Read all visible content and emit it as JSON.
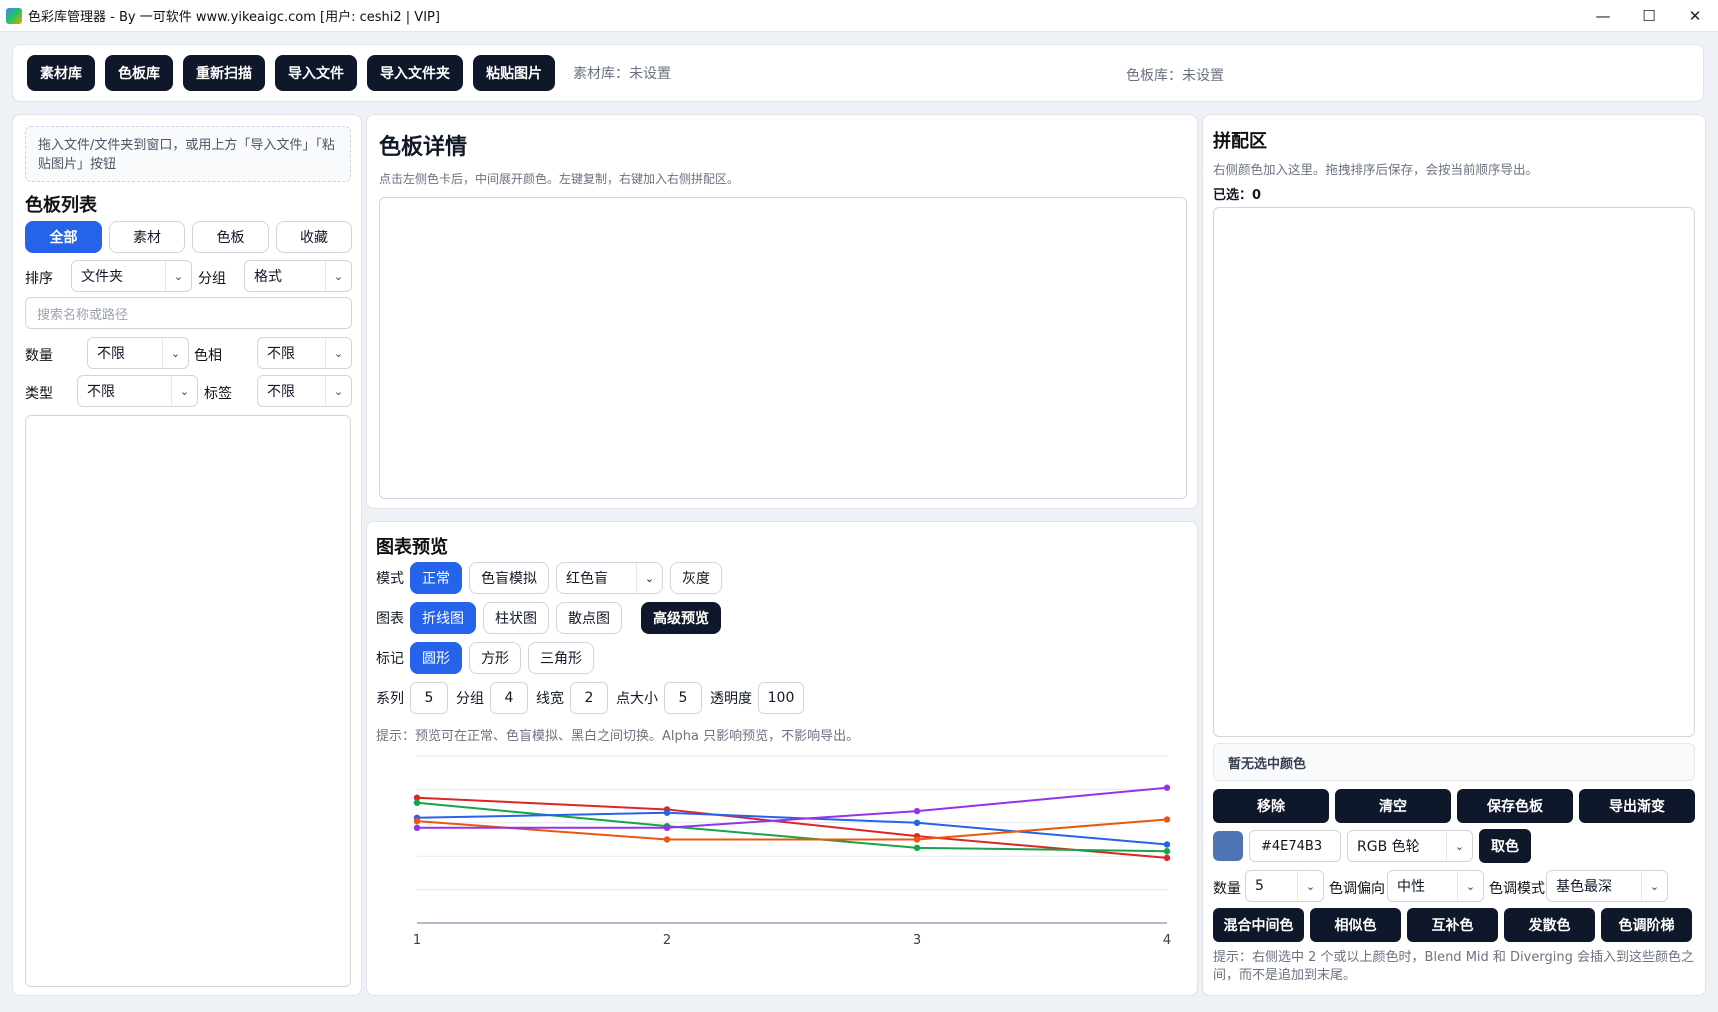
{
  "window": {
    "title": "色彩库管理器 - By 一可软件 www.yikeaigc.com  [用户: ceshi2 | VIP]",
    "minimize": "—",
    "maximize": "☐",
    "close": "✕"
  },
  "toolbar": {
    "buttons": [
      "素材库",
      "色板库",
      "重新扫描",
      "导入文件",
      "导入文件夹",
      "粘贴图片"
    ],
    "asset_status": "素材库：未设置",
    "palette_status": "色板库：未设置"
  },
  "left": {
    "dropzone_text": "拖入文件/文件夹到窗口，或用上方「导入文件」「粘贴图片」按钮",
    "title": "色板列表",
    "tabs": [
      "全部",
      "素材",
      "色板",
      "收藏"
    ],
    "sort_label": "排序",
    "sort_value": "文件夹",
    "group_label": "分组",
    "group_value": "格式",
    "search_placeholder": "搜索名称或路径",
    "count_label": "数量",
    "count_value": "不限",
    "hue_label": "色相",
    "hue_value": "不限",
    "type_label": "类型",
    "type_value": "不限",
    "tag_label": "标签",
    "tag_value": "不限"
  },
  "detail": {
    "title": "色板详情",
    "subtitle": "点击左侧色卡后，中间展开颜色。左键复制，右键加入右侧拼配区。"
  },
  "preview": {
    "title": "图表预览",
    "mode_label": "模式",
    "mode_normal": "正常",
    "mode_cb": "色盲模拟",
    "cb_type": "红色盲",
    "mode_gray": "灰度",
    "chart_label": "图表",
    "chart_line": "折线图",
    "chart_bar": "柱状图",
    "chart_scatter": "散点图",
    "advanced": "高级预览",
    "marker_label": "标记",
    "marker_circle": "圆形",
    "marker_square": "方形",
    "marker_triangle": "三角形",
    "series_label": "系列",
    "series_value": "5",
    "groups_label": "分组",
    "groups_value": "4",
    "linewidth_label": "线宽",
    "linewidth_value": "2",
    "pointsize_label": "点大小",
    "pointsize_value": "5",
    "opacity_label": "透明度",
    "opacity_value": "100",
    "tip": "提示：预览可在正常、色盲模拟、黑白之间切换。Alpha 只影响预览，不影响导出。"
  },
  "chart_data": {
    "type": "line",
    "x": [
      1,
      2,
      3,
      4
    ],
    "ylim": [
      0,
      10
    ],
    "grid": true,
    "series": [
      {
        "color": "#dc2626",
        "values": [
          7.5,
          6.8,
          5.2,
          3.9
        ]
      },
      {
        "color": "#16a34a",
        "values": [
          7.2,
          5.8,
          4.5,
          4.3
        ]
      },
      {
        "color": "#2563eb",
        "values": [
          6.3,
          6.6,
          6.0,
          4.7
        ]
      },
      {
        "color": "#ea580c",
        "values": [
          6.1,
          5.0,
          5.0,
          6.2
        ]
      },
      {
        "color": "#9333ea",
        "values": [
          5.7,
          5.7,
          6.7,
          8.1
        ]
      }
    ]
  },
  "right": {
    "title": "拼配区",
    "subtitle": "右侧颜色加入这里。拖拽排序后保存，会按当前顺序导出。",
    "selected_label": "已选：",
    "selected_count": "0",
    "no_selection": "暂无选中颜色",
    "actions": [
      "移除",
      "清空",
      "保存色板",
      "导出渐变"
    ],
    "current_color": "#4E74B3",
    "color_model": "RGB 色轮",
    "pick_button": "取色",
    "count_label": "数量",
    "count_value": "5",
    "tone_label": "色调偏向",
    "tone_value": "中性",
    "tone_mode_label": "色调模式",
    "tone_mode_value": "基色最深",
    "gen_buttons": [
      "混合中间色",
      "相似色",
      "互补色",
      "发散色",
      "色调阶梯"
    ],
    "hint": "提示：右侧选中 2 个或以上颜色时，Blend Mid 和 Diverging 会插入到这些颜色之间，而不是追加到末尾。"
  }
}
